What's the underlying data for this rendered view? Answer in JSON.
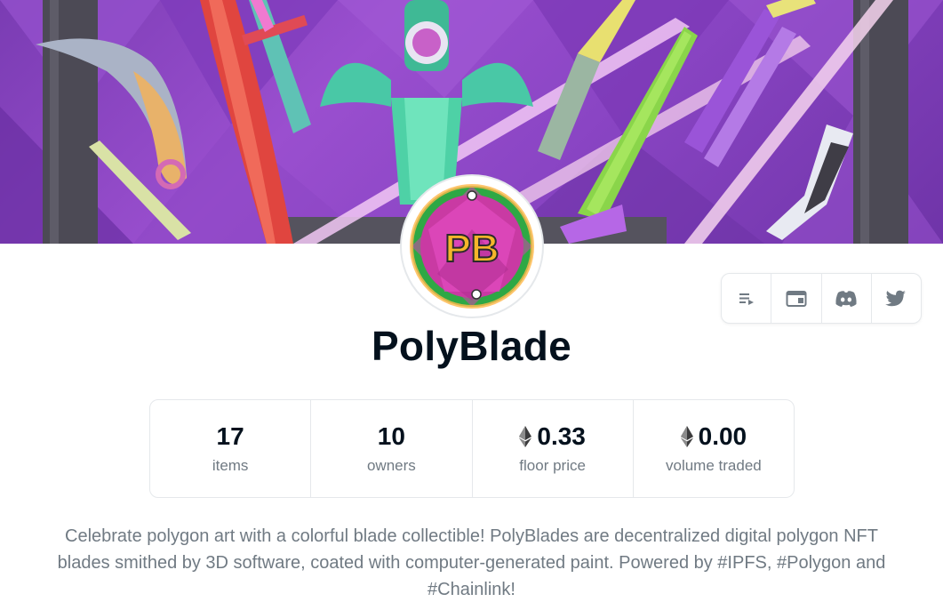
{
  "collection": {
    "name": "PolyBlade",
    "avatar_text": "PB",
    "description": "Celebrate polygon art with a colorful blade collectible! PolyBlades are decentralized digital polygon NFT blades smithed by 3D software, coated with computer-generated paint. Powered by #IPFS, #Polygon and #Chainlink!"
  },
  "social_icons": [
    "activity-list-icon",
    "website-icon",
    "discord-icon",
    "twitter-icon"
  ],
  "stats": [
    {
      "value": "17",
      "label": "items",
      "eth": false
    },
    {
      "value": "10",
      "label": "owners",
      "eth": false
    },
    {
      "value": "0.33",
      "label": "floor price",
      "eth": true
    },
    {
      "value": "0.00",
      "label": "volume traded",
      "eth": true
    }
  ],
  "colors": {
    "banner_purple": "#8a45c4",
    "title": "#04111d",
    "muted": "#707a83",
    "border": "#e5e8eb",
    "social_icon": "#707a83"
  }
}
